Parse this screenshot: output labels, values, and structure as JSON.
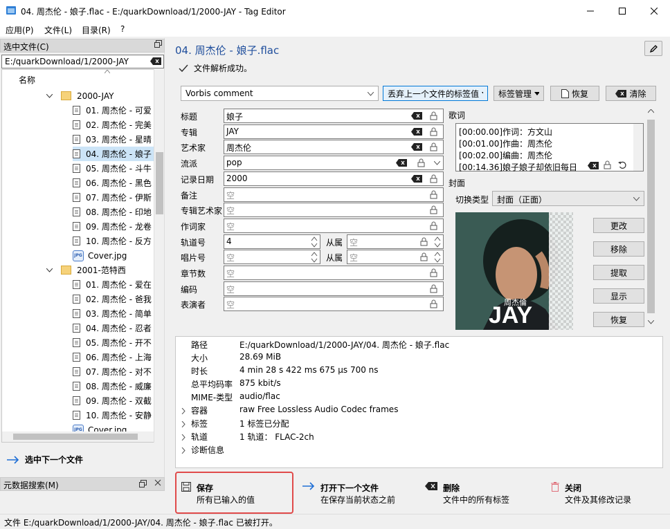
{
  "window": {
    "title": "04. 周杰伦 - 娘子.flac - E:/quarkDownload/1/2000-JAY - Tag Editor",
    "minimize": "—",
    "maximize": "☐",
    "close": "✕"
  },
  "menu": [
    "应用(P)",
    "文件(L)",
    "目录(R)",
    "?"
  ],
  "left": {
    "header": "选中文件(C)",
    "path": "E:/quarkDownload/1/2000-JAY",
    "column": "名称",
    "tree": [
      {
        "type": "folder",
        "label": "2000-JAY",
        "level": 1
      },
      {
        "type": "file",
        "label": "01. 周杰伦 - 可爱",
        "level": 2
      },
      {
        "type": "file",
        "label": "02. 周杰伦 - 完美",
        "level": 2
      },
      {
        "type": "file",
        "label": "03. 周杰伦 - 星晴",
        "level": 2
      },
      {
        "type": "file",
        "label": "04. 周杰伦 - 娘子",
        "level": 2,
        "selected": true
      },
      {
        "type": "file",
        "label": "05. 周杰伦 - 斗牛",
        "level": 2
      },
      {
        "type": "file",
        "label": "06. 周杰伦 - 黑色",
        "level": 2
      },
      {
        "type": "file",
        "label": "07. 周杰伦 - 伊斯",
        "level": 2
      },
      {
        "type": "file",
        "label": "08. 周杰伦 - 印地",
        "level": 2
      },
      {
        "type": "file",
        "label": "09. 周杰伦 - 龙卷",
        "level": 2
      },
      {
        "type": "file",
        "label": "10. 周杰伦 - 反方",
        "level": 2
      },
      {
        "type": "jpg",
        "label": "Cover.jpg",
        "level": 2
      },
      {
        "type": "folder",
        "label": "2001-范特西",
        "level": 1
      },
      {
        "type": "file",
        "label": "01. 周杰伦 - 爱在",
        "level": 2
      },
      {
        "type": "file",
        "label": "02. 周杰伦 - 爸我",
        "level": 2
      },
      {
        "type": "file",
        "label": "03. 周杰伦 - 简单",
        "level": 2
      },
      {
        "type": "file",
        "label": "04. 周杰伦 - 忍者",
        "level": 2
      },
      {
        "type": "file",
        "label": "05. 周杰伦 - 开不",
        "level": 2
      },
      {
        "type": "file",
        "label": "06. 周杰伦 - 上海",
        "level": 2
      },
      {
        "type": "file",
        "label": "07. 周杰伦 - 对不",
        "level": 2
      },
      {
        "type": "file",
        "label": "08. 周杰伦 - 威廉",
        "level": 2
      },
      {
        "type": "file",
        "label": "09. 周杰伦 - 双截",
        "level": 2
      },
      {
        "type": "file",
        "label": "10. 周杰伦 - 安静",
        "level": 2
      },
      {
        "type": "jpg",
        "label": "Cover.jpg",
        "level": 2
      }
    ],
    "next_file": "选中下一个文件",
    "meta_search": "元数据搜索(M)"
  },
  "main": {
    "file_title": "04. 周杰伦 - 娘子.flac",
    "parse_msg": "文件解析成功。",
    "tag_format": "Vorbis comment",
    "discard_btn": "丢弃上一个文件的标签值",
    "tag_mgmt_btn": "标签管理",
    "restore_btn": "恢复",
    "clear_btn": "清除",
    "fields": [
      {
        "label": "标题",
        "value": "娘子",
        "filled": true
      },
      {
        "label": "专辑",
        "value": "JAY",
        "filled": true
      },
      {
        "label": "艺术家",
        "value": "周杰伦",
        "filled": true
      },
      {
        "label": "流派",
        "value": "pop",
        "filled": true
      },
      {
        "label": "记录日期",
        "value": "2000",
        "filled": true
      },
      {
        "label": "备注",
        "value": "空",
        "filled": false
      },
      {
        "label": "专辑艺术家",
        "value": "空",
        "filled": false
      },
      {
        "label": "作词家",
        "value": "空",
        "filled": false
      },
      {
        "label": "轨道号",
        "value": "4",
        "filled": true
      },
      {
        "label": "唱片号",
        "value": "空",
        "filled": false
      },
      {
        "label": "章节数",
        "value": "空",
        "filled": false
      },
      {
        "label": "编码",
        "value": "空",
        "filled": false
      },
      {
        "label": "表演者",
        "value": "空",
        "filled": false
      }
    ],
    "of_label": "从属",
    "of_value": "空",
    "lyrics_label": "歌词",
    "lyrics": [
      "[00:00.00]作词：方文山",
      "[00:01.00]作曲：周杰伦",
      "[00:02.00]编曲：周杰伦",
      "[00:14.36]娘子娘子却依旧每日"
    ],
    "cover_label": "封面",
    "switch_type_label": "切换类型",
    "cover_type": "封面（正面）",
    "cover_buttons": [
      "更改",
      "移除",
      "提取",
      "显示",
      "恢复"
    ],
    "cover_art_text": "周杰倫",
    "cover_art_title": "JAY"
  },
  "details": [
    {
      "key": "路径",
      "value": "E:/quarkDownload/1/2000-JAY/04. 周杰伦 - 娘子.flac",
      "expandable": false
    },
    {
      "key": "大小",
      "value": "28.69 MiB",
      "expandable": false
    },
    {
      "key": "时长",
      "value": "4 min 28 s 422 ms 675 µs 700 ns",
      "expandable": false
    },
    {
      "key": "总平均码率",
      "value": "875 kbit/s",
      "expandable": false
    },
    {
      "key": "MIME-类型",
      "value": "audio/flac",
      "expandable": false
    },
    {
      "key": "容器",
      "value": "raw Free Lossless Audio Codec frames",
      "expandable": true
    },
    {
      "key": "标签",
      "value": "1 标签已分配",
      "expandable": true
    },
    {
      "key": "轨道",
      "value": "1 轨道：  FLAC-2ch",
      "expandable": true
    },
    {
      "key": "诊断信息",
      "value": "",
      "expandable": true
    }
  ],
  "actions": {
    "save": {
      "t1": "保存",
      "t2": "所有已输入的值"
    },
    "open_next": {
      "t1": "打开下一个文件",
      "t2": "在保存当前状态之前"
    },
    "delete": {
      "t1": "删除",
      "t2": "文件中的所有标签"
    },
    "close": {
      "t1": "关闭",
      "t2": "文件及其修改记录"
    }
  },
  "status": "文件 E:/quarkDownload/1/2000-JAY/04. 周杰伦 - 娘子.flac 已被打开。",
  "colors": {
    "accent": "#1f4e9c",
    "selected": "#cce4f7",
    "highlight": "#e04a4a"
  }
}
